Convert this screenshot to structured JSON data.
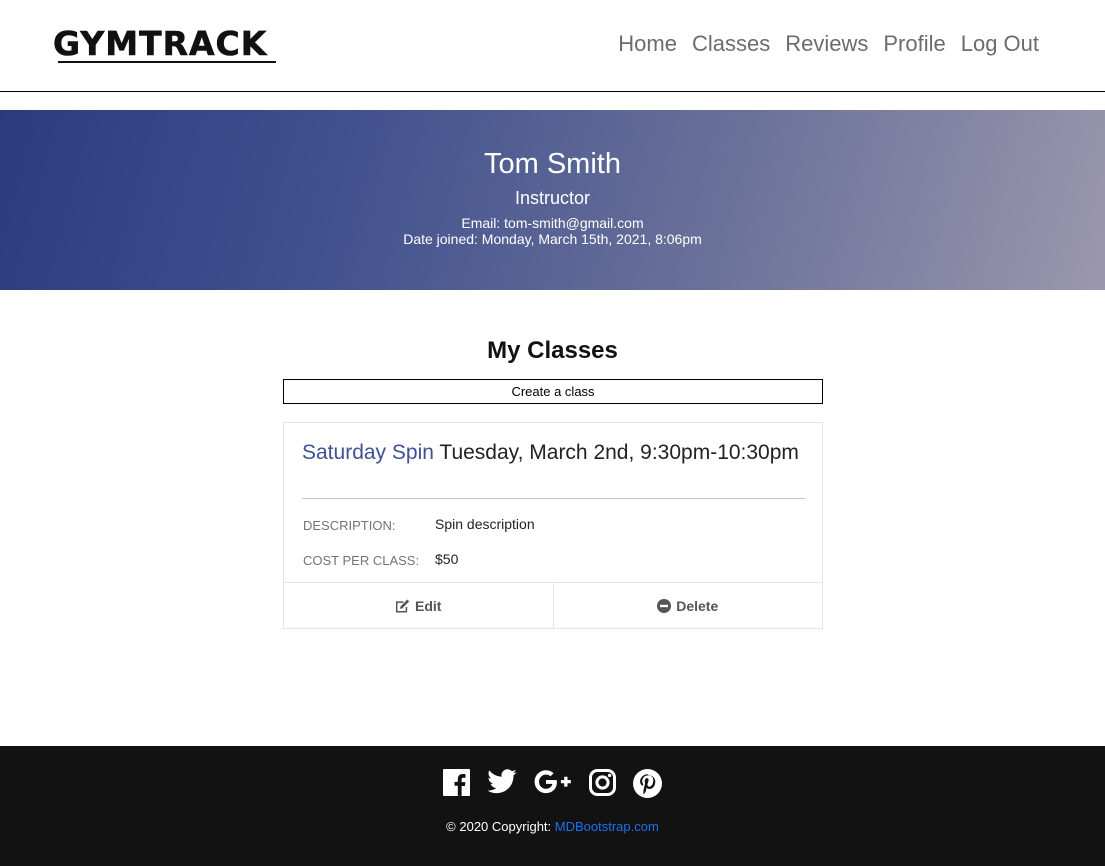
{
  "brand": {
    "logo_text": "GYMTRACK"
  },
  "nav": {
    "items": [
      "Home",
      "Classes",
      "Reviews",
      "Profile",
      "Log Out"
    ]
  },
  "profile": {
    "name": "Tom Smith",
    "role": "Instructor",
    "email_line": "Email: tom-smith@gmail.com",
    "joined_line": "Date joined: Monday, March 15th, 2021, 8:06pm"
  },
  "classes_section": {
    "title": "My Classes",
    "create_label": "Create a class",
    "cards": [
      {
        "name": "Saturday Spin",
        "schedule": "Tuesday, March 2nd, 9:30pm-10:30pm",
        "description_label": "Description:",
        "description": "Spin description",
        "cost_label": "Cost per class:",
        "cost": "$50",
        "edit_label": "Edit",
        "delete_label": "Delete"
      }
    ]
  },
  "footer": {
    "socials": [
      "facebook-icon",
      "twitter-icon",
      "google-plus-icon",
      "instagram-icon",
      "pinterest-icon"
    ],
    "copyright_prefix": "© 2020 Copyright:",
    "copyright_link": "MDBootstrap.com",
    "link_color": "#1e6ff0"
  },
  "colors": {
    "hero_gradient_start": "#2c3b7e",
    "hero_gradient_end": "#9b97ae",
    "class_name": "#3d5196",
    "footer_bg": "#121212"
  }
}
